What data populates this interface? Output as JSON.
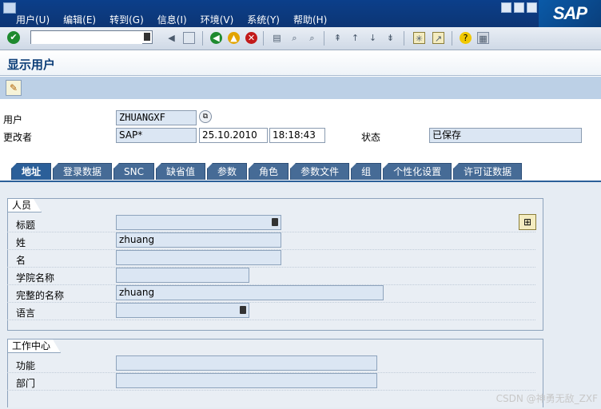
{
  "menu": {
    "items": [
      "用户(U)",
      "编辑(E)",
      "转到(G)",
      "信息(I)",
      "环境(V)",
      "系统(Y)",
      "帮助(H)"
    ],
    "logo": "SAP"
  },
  "toolbar": {
    "command_value": "",
    "icons": [
      "enter-icon",
      "back-icon",
      "save-icon",
      "green-back-icon",
      "exit-icon",
      "cancel-icon",
      "print-icon",
      "find-icon",
      "find-next-icon",
      "first-page-icon",
      "prev-page-icon",
      "next-page-icon",
      "last-page-icon",
      "new-session-icon",
      "shortcut-icon",
      "help-icon",
      "customize-layout-icon"
    ]
  },
  "page": {
    "title": "显示用户"
  },
  "header": {
    "user_label": "用户",
    "user_value": "ZHUANGXF",
    "changed_by_label": "更改者",
    "changed_by_value": "SAP*",
    "changed_date": "25.10.2010",
    "changed_time": "18:18:43",
    "status_label": "状态",
    "status_value": "已保存"
  },
  "tabs": [
    "地址",
    "登录数据",
    "SNC",
    "缺省值",
    "参数",
    "角色",
    "参数文件",
    "组",
    "个性化设置",
    "许可证数据"
  ],
  "active_tab": "地址",
  "person": {
    "title": "人员",
    "fields": [
      {
        "label": "标题",
        "value": ""
      },
      {
        "label": "姓",
        "value": "zhuang"
      },
      {
        "label": "名",
        "value": ""
      },
      {
        "label": "学院名称",
        "value": ""
      },
      {
        "label": "完整的名称",
        "value": "zhuang"
      },
      {
        "label": "语言",
        "value": ""
      }
    ]
  },
  "workcenter": {
    "title": "工作中心",
    "fields": [
      {
        "label": "功能",
        "value": ""
      },
      {
        "label": "部门",
        "value": ""
      }
    ]
  },
  "watermark": "CSDN @神勇无敌_ZXF"
}
